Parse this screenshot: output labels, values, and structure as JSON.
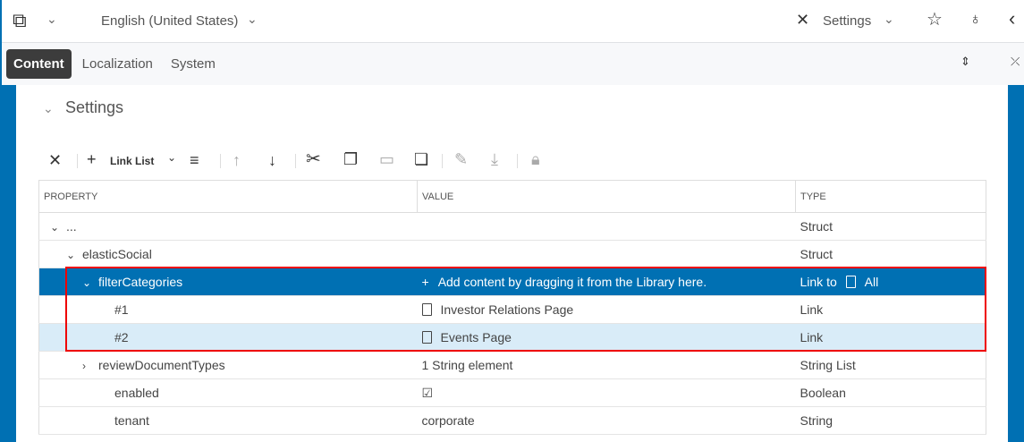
{
  "header": {
    "language": "English (United States)",
    "workspace": "Settings"
  },
  "tabs": [
    "Content",
    "Localization",
    "System"
  ],
  "section": {
    "title": "Settings"
  },
  "toolbar": {
    "link_list": "Link List"
  },
  "table": {
    "headers": [
      "PROPERTY",
      "VALUE",
      "TYPE"
    ],
    "rows": [
      {
        "property": "...",
        "value": "",
        "type": "Struct",
        "indent": 0,
        "expander": "open"
      },
      {
        "property": "elasticSocial",
        "value": "",
        "type": "Struct",
        "indent": 1,
        "expander": "open"
      },
      {
        "property": "filterCategories",
        "value": "Add content by dragging it from the Library here.",
        "type": "Link to",
        "type_extra": "All",
        "indent": 2,
        "expander": "open",
        "state": "selected"
      },
      {
        "property": "#1",
        "value": "Investor Relations Page",
        "type": "Link",
        "indent": 3,
        "doc": true
      },
      {
        "property": "#2",
        "value": "Events Page",
        "type": "Link",
        "indent": 3,
        "doc": true,
        "state": "highlight"
      },
      {
        "property": "reviewDocumentTypes",
        "value": "1 String element",
        "type": "String List",
        "indent": 2,
        "expander": "closed"
      },
      {
        "property": "enabled",
        "value": "☑",
        "type": "Boolean",
        "indent": 3
      },
      {
        "property": "tenant",
        "value": "corporate",
        "type": "String",
        "indent": 3
      }
    ]
  }
}
